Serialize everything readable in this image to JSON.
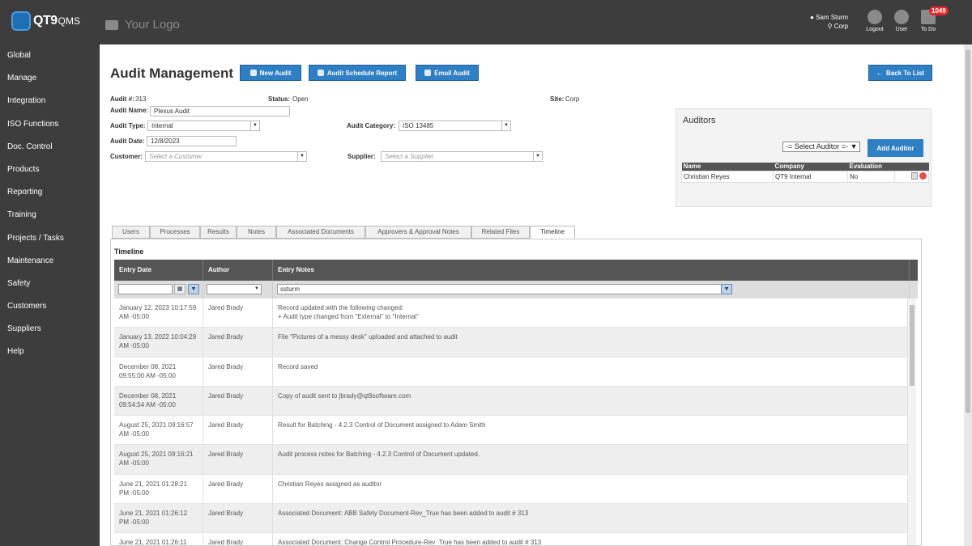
{
  "brand": {
    "name": "QT9",
    "suffix": "QMS",
    "your_logo": "Your Logo"
  },
  "topbar": {
    "user_name": "Sam Sturm",
    "site": "Corp",
    "logout": "Logout",
    "user": "User",
    "todo": "To Do",
    "todo_count": "1049"
  },
  "sidebar": {
    "items": [
      "Global",
      "Manage",
      "Integration",
      "ISO Functions",
      "Doc. Control",
      "Products",
      "Reporting",
      "Training",
      "Projects / Tasks",
      "Maintenance",
      "Safety",
      "Customers",
      "Suppliers",
      "Help"
    ]
  },
  "page": {
    "title": "Audit Management",
    "new_audit": "New Audit",
    "schedule_report": "Audit Schedule Report",
    "email_audit": "Email Audit",
    "back_to_list": "Back To List"
  },
  "form": {
    "audit_no_label": "Audit #:",
    "audit_no": "313",
    "status_label": "Status:",
    "status": "Open",
    "site_label": "Site:",
    "site": "Corp",
    "name_label": "Audit Name:",
    "name": "Plexus Audit",
    "type_label": "Audit Type:",
    "type": "Internal",
    "category_label": "Audit Category:",
    "category": "ISO 13485",
    "date_label": "Audit Date:",
    "date": "12/8/2023",
    "customer_label": "Customer:",
    "customer_placeholder": "Select a Customer",
    "supplier_label": "Supplier:",
    "supplier_placeholder": "Select a Supplier"
  },
  "auditors": {
    "title": "Auditors",
    "select": "-= Select Auditor =-",
    "add": "Add Auditor",
    "headers": [
      "Name",
      "Company",
      "Evaluation"
    ],
    "rows": [
      {
        "name": "Christian Reyes",
        "company": "QT9 Internal",
        "evaluation": "No"
      }
    ]
  },
  "tabs": [
    "Users",
    "Processes",
    "Results",
    "Notes",
    "Associated Documents",
    "Approvers & Approval Notes",
    "Related Files",
    "Timeline"
  ],
  "timeline": {
    "title": "Timeline",
    "headers": [
      "Entry Date",
      "Author",
      "Entry Notes"
    ],
    "filter_notes": "ssturm",
    "rows": [
      {
        "date": "January 12, 2023 10:17:59 AM -05:00",
        "author": "Jared Brady",
        "note": "Record updated with the following changed:",
        "note2": "+ Audit type changed from \"External\" to \"Internal\""
      },
      {
        "date": "January 13, 2022 10:04:29 AM -05:00",
        "author": "Jared Brady",
        "note": "File \"Pictures of a messy desk\" uploaded and attached to audit",
        "note2": ""
      },
      {
        "date": "December 08, 2021 09:55:00 AM -05:00",
        "author": "Jared Brady",
        "note": "Record saved",
        "note2": ""
      },
      {
        "date": "December 08, 2021 09:54:54 AM -05:00",
        "author": "Jared Brady",
        "note": "Copy of audit sent to jbrady@qt9software.com",
        "note2": ""
      },
      {
        "date": "August 25, 2021 09:16:57 AM -05:00",
        "author": "Jared Brady",
        "note": "Result for Batching - 4.2.3 Control of Document assigned to Adam Smith",
        "note2": ""
      },
      {
        "date": "August 25, 2021 09:16:21 AM -05:00",
        "author": "Jared Brady",
        "note": "Audit process notes for Batching - 4.2.3 Control of Document updated.",
        "note2": ""
      },
      {
        "date": "June 21, 2021 01:28:21 PM -05:00",
        "author": "Jared Brady",
        "note": "Christian Reyes assigned as auditor",
        "note2": ""
      },
      {
        "date": "June 21, 2021 01:26:12 PM -05:00",
        "author": "Jared Brady",
        "note": "Associated Document: ABB Safety Document-Rev_True has been added to audit # 313",
        "note2": ""
      },
      {
        "date": "June 21, 2021 01:26:11",
        "author": "Jared Brady",
        "note": "Associated Document: Change Control Procedure-Rev_True has been added to audit # 313",
        "note2": ""
      }
    ]
  }
}
